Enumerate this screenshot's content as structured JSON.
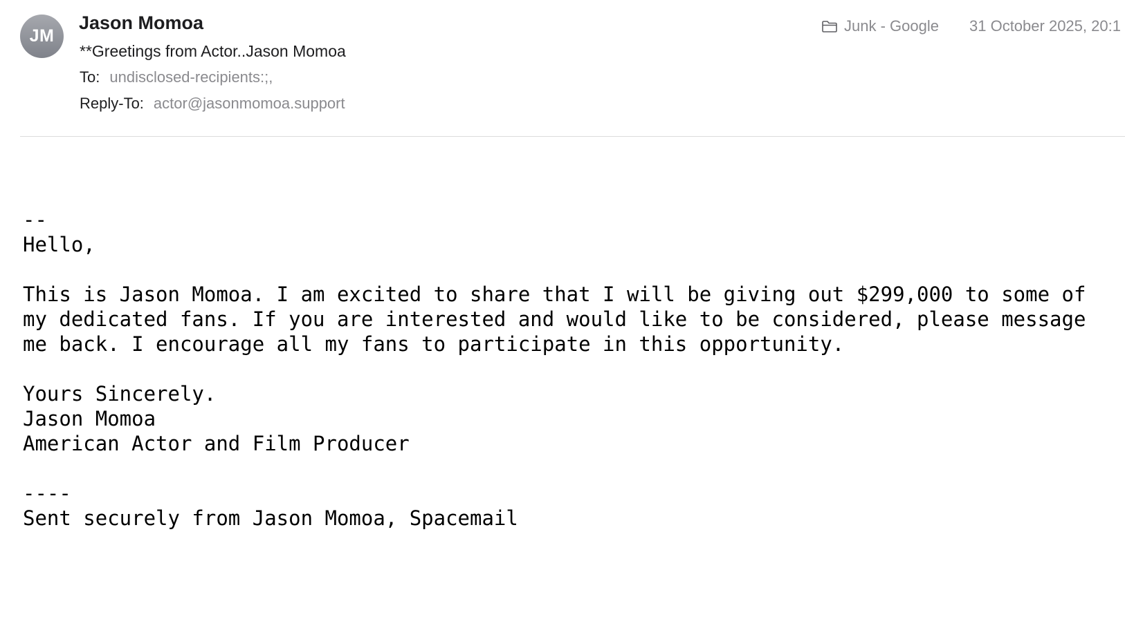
{
  "message": {
    "avatar_initials": "JM",
    "sender_name": "Jason Momoa",
    "subject": "**Greetings from Actor..Jason Momoa",
    "to_label": "To:",
    "to_value": "undisclosed-recipients:;,",
    "reply_to_label": "Reply-To:",
    "reply_to_value": "actor@jasonmomoa.support",
    "mailbox_icon": "folder-icon",
    "mailbox": "Junk - Google",
    "date": "31 October 2025, 20:1"
  },
  "body": {
    "lines": [
      "--",
      "Hello,",
      "",
      "This is Jason Momoa. I am excited to share that I will be giving out $299,000 to some of",
      "my dedicated fans. If you are interested and would like to be considered, please message",
      "me back. I encourage all my fans to participate in this opportunity.",
      "",
      "Yours Sincerely.",
      "Jason Momoa",
      "American Actor and Film Producer",
      "",
      "----",
      "Sent securely from Jason Momoa, Spacemail"
    ]
  },
  "colors": {
    "avatar_top": "#a6a8ae",
    "avatar_bottom": "#7f828a",
    "secondary_text": "#8a8a8e",
    "divider": "#dcdcdc"
  }
}
